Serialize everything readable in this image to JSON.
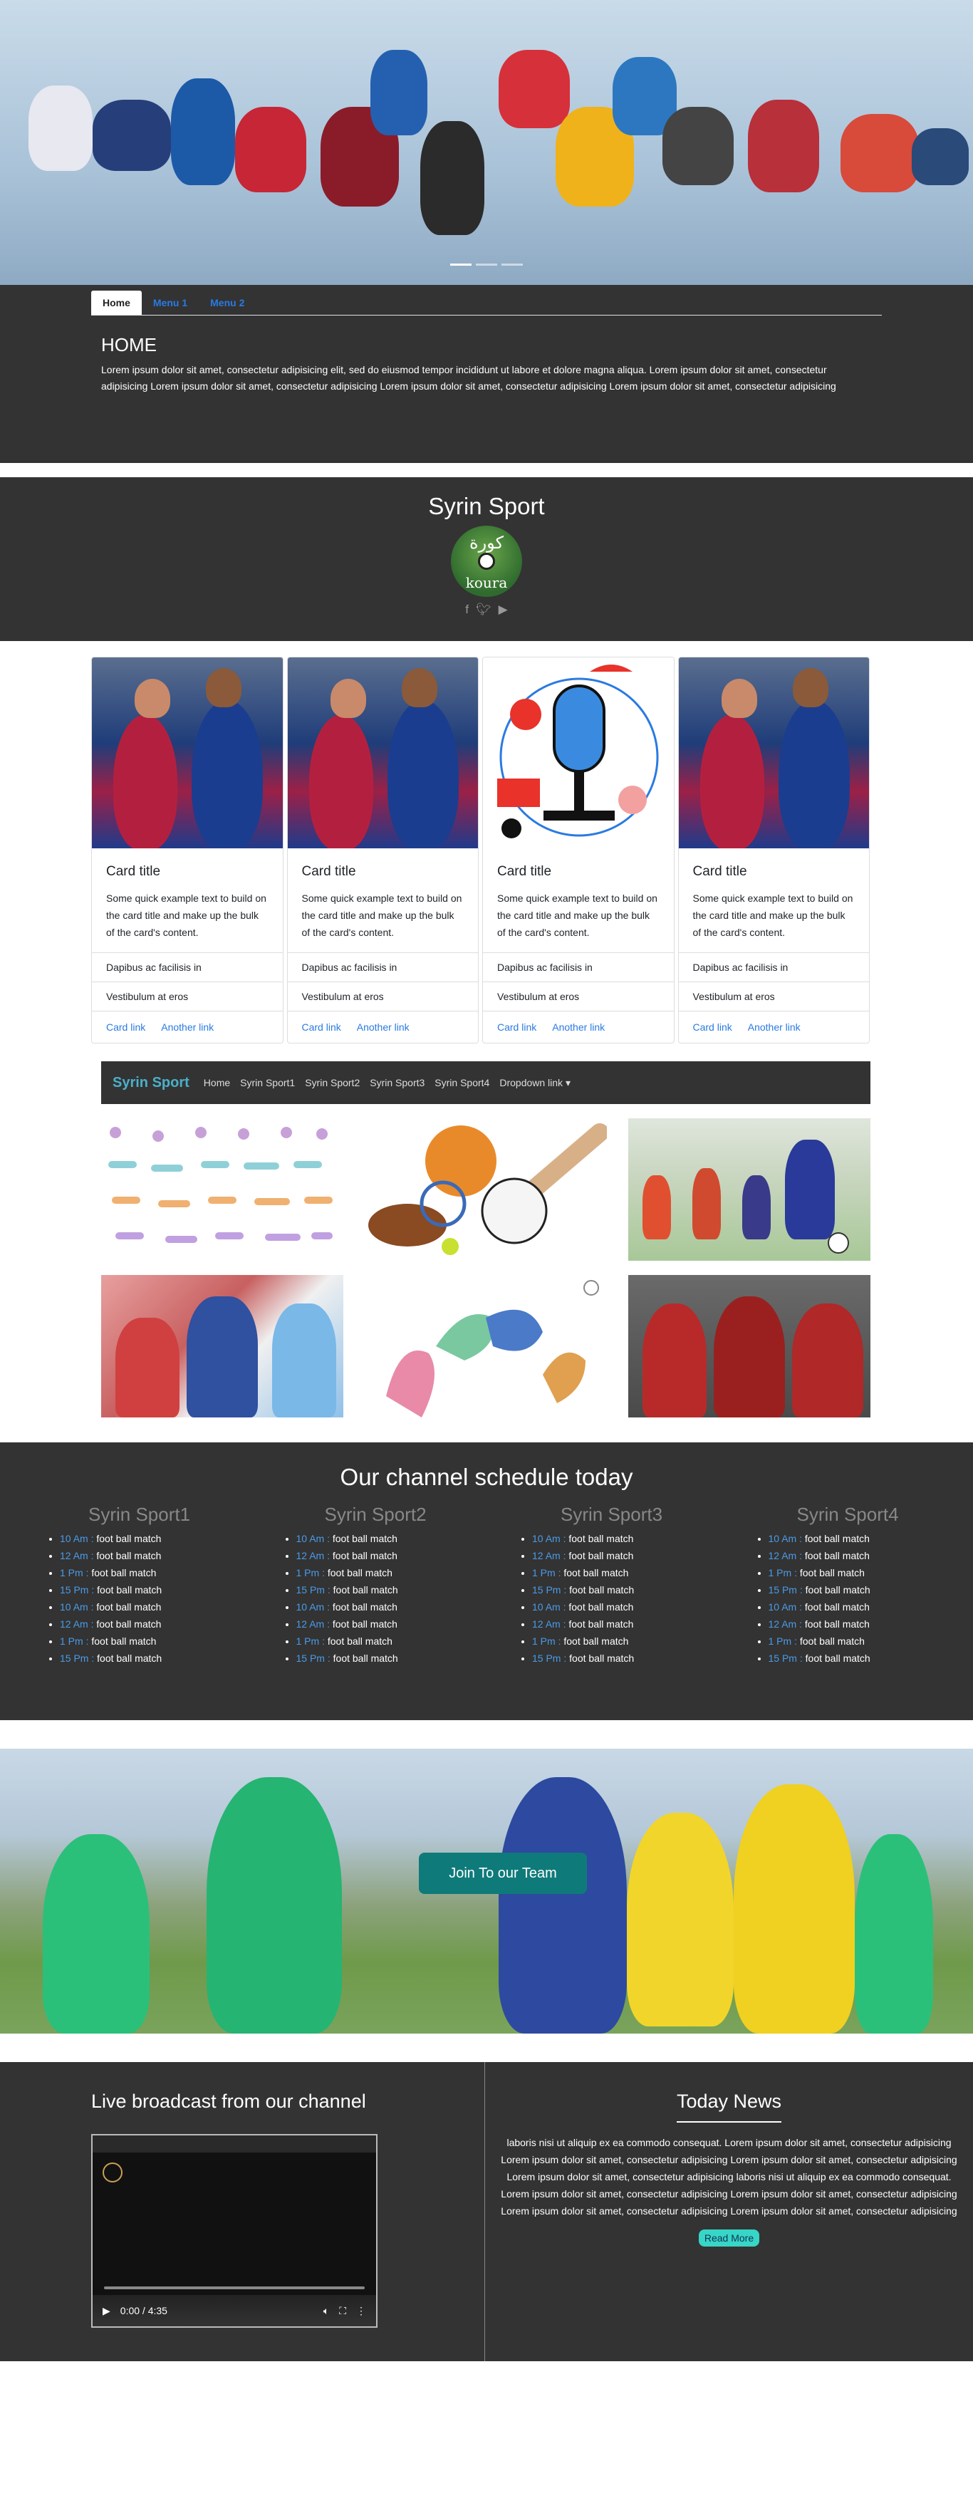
{
  "tabs": {
    "items": [
      {
        "label": "Home"
      },
      {
        "label": "Menu 1"
      },
      {
        "label": "Menu 2"
      }
    ],
    "heading": "HOME",
    "text": "Lorem ipsum dolor sit amet, consectetur adipisicing elit, sed do eiusmod tempor incididunt ut labore et dolore magna aliqua. Lorem ipsum dolor sit amet, consectetur adipisicing Lorem ipsum dolor sit amet, consectetur adipisicing Lorem ipsum dolor sit amet, consectetur adipisicing Lorem ipsum dolor sit amet, consectetur adipisicing"
  },
  "header": {
    "title": "Syrin Sport",
    "logo_text_arabic": "كورة",
    "logo_text_latin": "koura",
    "social": [
      "facebook-icon",
      "twitter-icon",
      "youtube-icon"
    ]
  },
  "cards": [
    {
      "title": "Card title",
      "text": "Some quick example text to build on the card title and make up the bulk of the card's content.",
      "item1": "Dapibus ac facilisis in",
      "item2": "Vestibulum at eros",
      "link1": "Card link",
      "link2": "Another link"
    },
    {
      "title": "Card title",
      "text": "Some quick example text to build on the card title and make up the bulk of the card's content.",
      "item1": "Dapibus ac facilisis in",
      "item2": "Vestibulum at eros",
      "link1": "Card link",
      "link2": "Another link"
    },
    {
      "title": "Card title",
      "text": "Some quick example text to build on the card title and make up the bulk of the card's content.",
      "item1": "Dapibus ac facilisis in",
      "item2": "Vestibulum at eros",
      "link1": "Card link",
      "link2": "Another link"
    },
    {
      "title": "Card title",
      "text": "Some quick example text to build on the card title and make up the bulk of the card's content.",
      "item1": "Dapibus ac facilisis in",
      "item2": "Vestibulum at eros",
      "link1": "Card link",
      "link2": "Another link"
    }
  ],
  "gallery_nav": {
    "brand": "Syrin Sport",
    "items": [
      "Home",
      "Syrin Sport1",
      "Syrin Sport2",
      "Syrin Sport3",
      "Syrin Sport4",
      "Dropdown link"
    ]
  },
  "schedule": {
    "title": "Our channel schedule today",
    "channels": [
      {
        "name": "Syrin Sport1",
        "items": [
          {
            "t": "10 Am :",
            "e": "foot ball match"
          },
          {
            "t": "12 Am :",
            "e": "foot ball match"
          },
          {
            "t": "1 Pm :",
            "e": "foot ball match"
          },
          {
            "t": "15 Pm :",
            "e": "foot ball match"
          },
          {
            "t": "10 Am :",
            "e": "foot ball match"
          },
          {
            "t": "12 Am :",
            "e": "foot ball match"
          },
          {
            "t": "1 Pm :",
            "e": "foot ball match"
          },
          {
            "t": "15 Pm :",
            "e": "foot ball match"
          }
        ]
      },
      {
        "name": "Syrin Sport2",
        "items": [
          {
            "t": "10 Am :",
            "e": "foot ball match"
          },
          {
            "t": "12 Am :",
            "e": "foot ball match"
          },
          {
            "t": "1 Pm :",
            "e": "foot ball match"
          },
          {
            "t": "15 Pm :",
            "e": "foot ball match"
          },
          {
            "t": "10 Am :",
            "e": "foot ball match"
          },
          {
            "t": "12 Am :",
            "e": "foot ball match"
          },
          {
            "t": "1 Pm :",
            "e": "foot ball match"
          },
          {
            "t": "15 Pm :",
            "e": "foot ball match"
          }
        ]
      },
      {
        "name": "Syrin Sport3",
        "items": [
          {
            "t": "10 Am :",
            "e": "foot ball match"
          },
          {
            "t": "12 Am :",
            "e": "foot ball match"
          },
          {
            "t": "1 Pm :",
            "e": "foot ball match"
          },
          {
            "t": "15 Pm :",
            "e": "foot ball match"
          },
          {
            "t": "10 Am :",
            "e": "foot ball match"
          },
          {
            "t": "12 Am :",
            "e": "foot ball match"
          },
          {
            "t": "1 Pm :",
            "e": "foot ball match"
          },
          {
            "t": "15 Pm :",
            "e": "foot ball match"
          }
        ]
      },
      {
        "name": "Syrin Sport4",
        "items": [
          {
            "t": "10 Am :",
            "e": "foot ball match"
          },
          {
            "t": "12 Am :",
            "e": "foot ball match"
          },
          {
            "t": "1 Pm :",
            "e": "foot ball match"
          },
          {
            "t": "15 Pm :",
            "e": "foot ball match"
          },
          {
            "t": "10 Am :",
            "e": "foot ball match"
          },
          {
            "t": "12 Am :",
            "e": "foot ball match"
          },
          {
            "t": "1 Pm :",
            "e": "foot ball match"
          },
          {
            "t": "15 Pm :",
            "e": "foot ball match"
          }
        ]
      }
    ]
  },
  "banner": {
    "button": "Join To our Team"
  },
  "live": {
    "title": "Live broadcast from our channel",
    "video_time": "0:00 / 4:35"
  },
  "news": {
    "title": "Today News",
    "text": "laboris nisi ut aliquip ex ea commodo consequat. Lorem ipsum dolor sit amet, consectetur adipisicing Lorem ipsum dolor sit amet, consectetur adipisicing Lorem ipsum dolor sit amet, consectetur adipisicing Lorem ipsum dolor sit amet, consectetur adipisicing laboris nisi ut aliquip ex ea commodo consequat. Lorem ipsum dolor sit amet, consectetur adipisicing Lorem ipsum dolor sit amet, consectetur adipisicing Lorem ipsum dolor sit amet, consectetur adipisicing Lorem ipsum dolor sit amet, consectetur adipisicing",
    "button": "Read More"
  },
  "colors": {
    "dark": "#333333",
    "link": "#2a7ae2",
    "brand": "#4bb0c9",
    "join": "#0f7a7a",
    "read": "#37d6c6"
  }
}
